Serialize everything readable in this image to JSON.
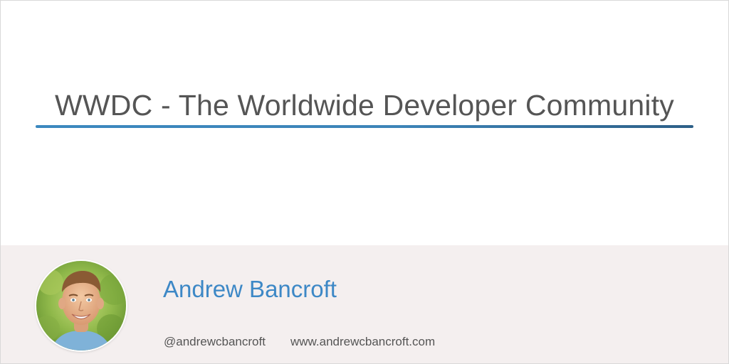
{
  "post": {
    "title": "WWDC - The Worldwide Developer Community"
  },
  "author": {
    "name": "Andrew Bancroft",
    "handle": "@andrewcbancroft",
    "website": "www.andrewcbancroft.com"
  },
  "colors": {
    "title_text": "#555555",
    "accent_rule": "#3b88bf",
    "author_name": "#3d88c6",
    "footer_background": "#f4efef"
  }
}
